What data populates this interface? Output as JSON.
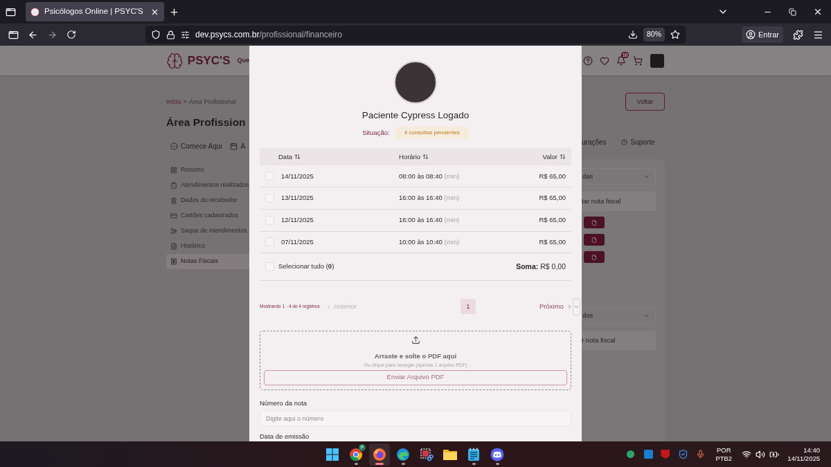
{
  "browser": {
    "tab_title": "Psicólogos Online | PSYC'S",
    "url_host": "dev.psycs.com.br",
    "url_path": "/profissional/financeiro",
    "zoom": "80%",
    "account_button": "Entrar"
  },
  "page": {
    "logo": "PSYC'S",
    "header_link": "Que",
    "notification_count": "10",
    "breadcrumb": [
      {
        "label": "Início",
        "selected": false
      },
      {
        "label": ">",
        "selected": false
      },
      {
        "label": "Área Profissional",
        "selected": true
      }
    ],
    "title": "Área Profission",
    "back_button": "Voltar",
    "tabs": [
      {
        "label": "Comece Aqui"
      },
      {
        "label": "A"
      }
    ],
    "right_tabs": [
      {
        "label": "urações",
        "kind": "text"
      },
      {
        "label": "Suporte",
        "kind": "help"
      }
    ],
    "sidebar": [
      {
        "label": "Resumo",
        "selected": false
      },
      {
        "label": "Atendimentos realizados",
        "selected": false
      },
      {
        "label": "Dados do recebedor",
        "selected": false
      },
      {
        "label": "Cartões cadastrados",
        "selected": false
      },
      {
        "label": "Saque de Atendimentos",
        "selected": false
      },
      {
        "label": "Histórico",
        "selected": false
      },
      {
        "label": "Notas Fiscais",
        "selected": true
      }
    ],
    "panel_sections": [
      {
        "select": "das",
        "action": "tar nota fiscal",
        "file_buttons": [
          {
            "kind": "document"
          },
          {
            "kind": "document"
          },
          {
            "kind": "document"
          }
        ]
      },
      {
        "select": "dos",
        "action": "r nota fiscal"
      }
    ]
  },
  "modal": {
    "patient_name": "Paciente Cypress Logado",
    "status_label": "Situação:",
    "status_badge": "4 consultas pendentes",
    "columns": [
      "Data",
      "Horário",
      "Valor"
    ],
    "rows": [
      {
        "date": "14/11/2025",
        "time": "08:00 às 08:40",
        "unit": "(min)",
        "value": "R$ 65,00",
        "checked": false
      },
      {
        "date": "13/11/2025",
        "time": "16:00 às 16:40",
        "unit": "(min)",
        "value": "R$ 65,00",
        "checked": false
      },
      {
        "date": "12/11/2025",
        "time": "16:00 às 16:40",
        "unit": "(min)",
        "value": "R$ 65,00",
        "checked": false
      },
      {
        "date": "07/11/2025",
        "time": "10:00 às 10:40",
        "unit": "(min)",
        "value": "R$ 65,00",
        "checked": false
      }
    ],
    "select_all": {
      "label": "Selecionar tudo (**0**)",
      "checked": false
    },
    "sum": "**Soma:** R$ 0,00",
    "pagination": {
      "info": "Mostrando 1 - 4 de 4 registros",
      "previous": "Anterior",
      "pages": [
        {
          "label": "1",
          "selected": true
        }
      ],
      "next": "Próximo"
    },
    "upload": {
      "title": "Arraste e solte o PDF aqui",
      "hint": "Ou clique para navegar (apenas 1 arquivo PDF)",
      "button": "Enviar Arquivo PDF"
    },
    "fields": [
      {
        "label": "Número da nota",
        "placeholder": "Digite aqui o número"
      }
    ],
    "next_label": "Data de emissão"
  },
  "taskbar": {
    "apps": [
      {
        "kind": "start",
        "selected": false,
        "running": false
      },
      {
        "kind": "chrome",
        "selected": false,
        "running": true,
        "badge": "P"
      },
      {
        "kind": "firefox",
        "selected": true,
        "running": true
      },
      {
        "kind": "edge",
        "selected": false,
        "running": true
      },
      {
        "kind": "snipping",
        "selected": false,
        "running": false
      },
      {
        "kind": "files",
        "selected": false,
        "running": false
      },
      {
        "kind": "notepad",
        "selected": false,
        "running": true
      },
      {
        "kind": "discord",
        "selected": false,
        "running": true
      }
    ],
    "language": [
      "POR",
      "PTB2"
    ],
    "time": "14:40",
    "date": "14/11/2025"
  }
}
